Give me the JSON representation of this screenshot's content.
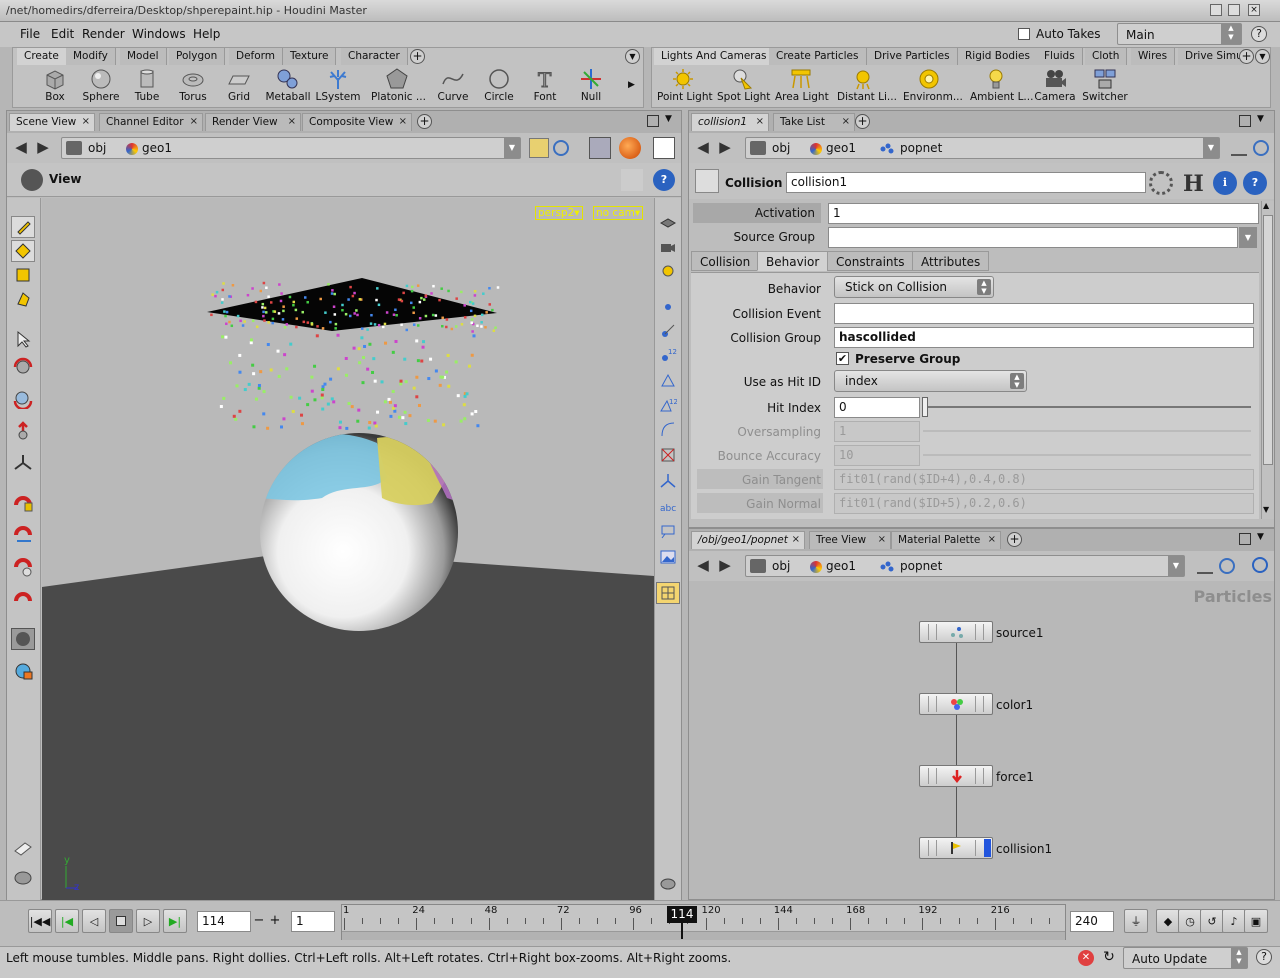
{
  "window": {
    "title": "/net/homedirs/dferreira/Desktop/shperepaint.hip - Houdini Master"
  },
  "menu": {
    "items": [
      "File",
      "Edit",
      "Render",
      "Windows",
      "Help"
    ],
    "auto_takes": "Auto Takes",
    "take": "Main"
  },
  "shelf_left": {
    "tabs": [
      "Create",
      "Modify",
      "Model",
      "Polygon",
      "Deform",
      "Texture",
      "Character"
    ],
    "tools": [
      "Box",
      "Sphere",
      "Tube",
      "Torus",
      "Grid",
      "Metaball",
      "LSystem",
      "Platonic ...",
      "Curve",
      "Circle",
      "Font",
      "Null"
    ]
  },
  "shelf_right": {
    "tabs": [
      "Lights And Cameras",
      "Create Particles",
      "Drive Particles",
      "Rigid Bodies",
      "Fluids",
      "Cloth",
      "Wires",
      "Drive Simu"
    ],
    "tools": [
      "Point Light",
      "Spot Light",
      "Area Light",
      "Distant Li...",
      "Environm...",
      "Ambient L...",
      "Camera",
      "Switcher"
    ]
  },
  "scene_pane": {
    "tabs": [
      "Scene View",
      "Channel Editor",
      "Render View",
      "Composite View"
    ],
    "path": [
      "obj",
      "geo1"
    ],
    "view_label": "View",
    "camera": "persp2",
    "cam_menu": "no cam"
  },
  "param_pane": {
    "tabs": [
      "collision1",
      "Take List"
    ],
    "path": [
      "obj",
      "geo1",
      "popnet"
    ],
    "node_type": "Collision",
    "node_name": "collision1",
    "activation_label": "Activation",
    "activation": "1",
    "source_group_label": "Source Group",
    "source_group": "",
    "subtabs": [
      "Collision",
      "Behavior",
      "Constraints",
      "Attributes"
    ],
    "behavior_label": "Behavior",
    "behavior": "Stick on Collision",
    "collision_event_label": "Collision Event",
    "collision_event": "",
    "collision_group_label": "Collision Group",
    "collision_group": "hascollided",
    "preserve_group": "Preserve Group",
    "hit_id_label": "Use as Hit ID",
    "hit_id": "index",
    "hit_index_label": "Hit Index",
    "hit_index": "0",
    "oversampling_label": "Oversampling",
    "oversampling": "1",
    "bounce_label": "Bounce Accuracy",
    "bounce": "10",
    "gain_tangent_label": "Gain Tangent",
    "gain_tangent": "fit01(rand($ID+4),0.4,0.8)",
    "gain_normal_label": "Gain Normal",
    "gain_normal": "fit01(rand($ID+5),0.2,0.6)"
  },
  "network_pane": {
    "tabs": [
      "/obj/geo1/popnet",
      "Tree View",
      "Material Palette"
    ],
    "path": [
      "obj",
      "geo1",
      "popnet"
    ],
    "context": "Particles",
    "nodes": [
      "source1",
      "color1",
      "force1",
      "collision1"
    ]
  },
  "timeline": {
    "frame": "114",
    "step": "1",
    "ticks": [
      "1",
      "24",
      "48",
      "72",
      "96",
      "120",
      "144",
      "168",
      "192",
      "216"
    ],
    "end": "240",
    "current_marker": "114"
  },
  "status": {
    "message": "Left mouse tumbles. Middle pans. Right dollies. Ctrl+Left rolls. Alt+Left rotates. Ctrl+Right box-zooms. Alt+Right zooms.",
    "update": "Auto Update"
  },
  "colors": {
    "viewport_bg": "#b9b9b9",
    "ground": "#4a4a4a",
    "accent_blue": "#2255dd",
    "cam_label": "#f0f000"
  }
}
